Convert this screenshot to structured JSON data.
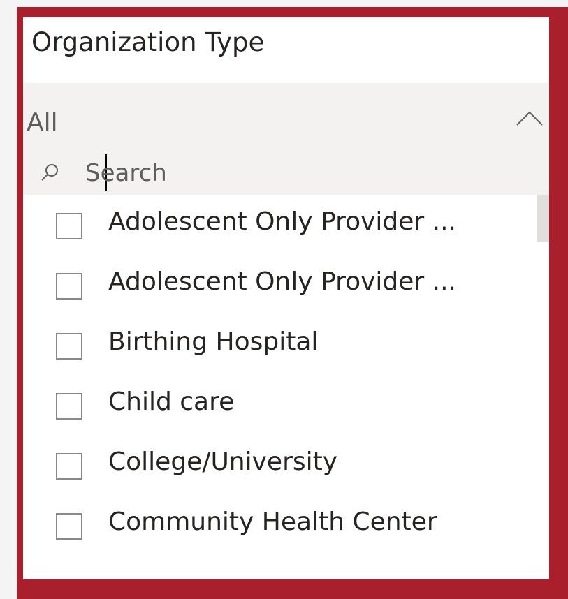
{
  "slicer": {
    "title": "Organization Type",
    "selected_value": "All",
    "search_placeholder": "Search",
    "items": [
      {
        "label": "Adolescent Only Provider ...",
        "checked": false
      },
      {
        "label": "Adolescent Only Provider ...",
        "checked": false
      },
      {
        "label": "Birthing Hospital",
        "checked": false
      },
      {
        "label": "Child care",
        "checked": false
      },
      {
        "label": "College/University",
        "checked": false
      },
      {
        "label": "Community Health Center",
        "checked": false
      }
    ]
  },
  "icons": {
    "dropdown": "chevron-up-icon",
    "search": "search-icon"
  },
  "colors": {
    "frame_border": "#a91f2b",
    "dropdown_background": "#f3f2f1",
    "text": "#252423",
    "muted_text": "#605e5c"
  }
}
